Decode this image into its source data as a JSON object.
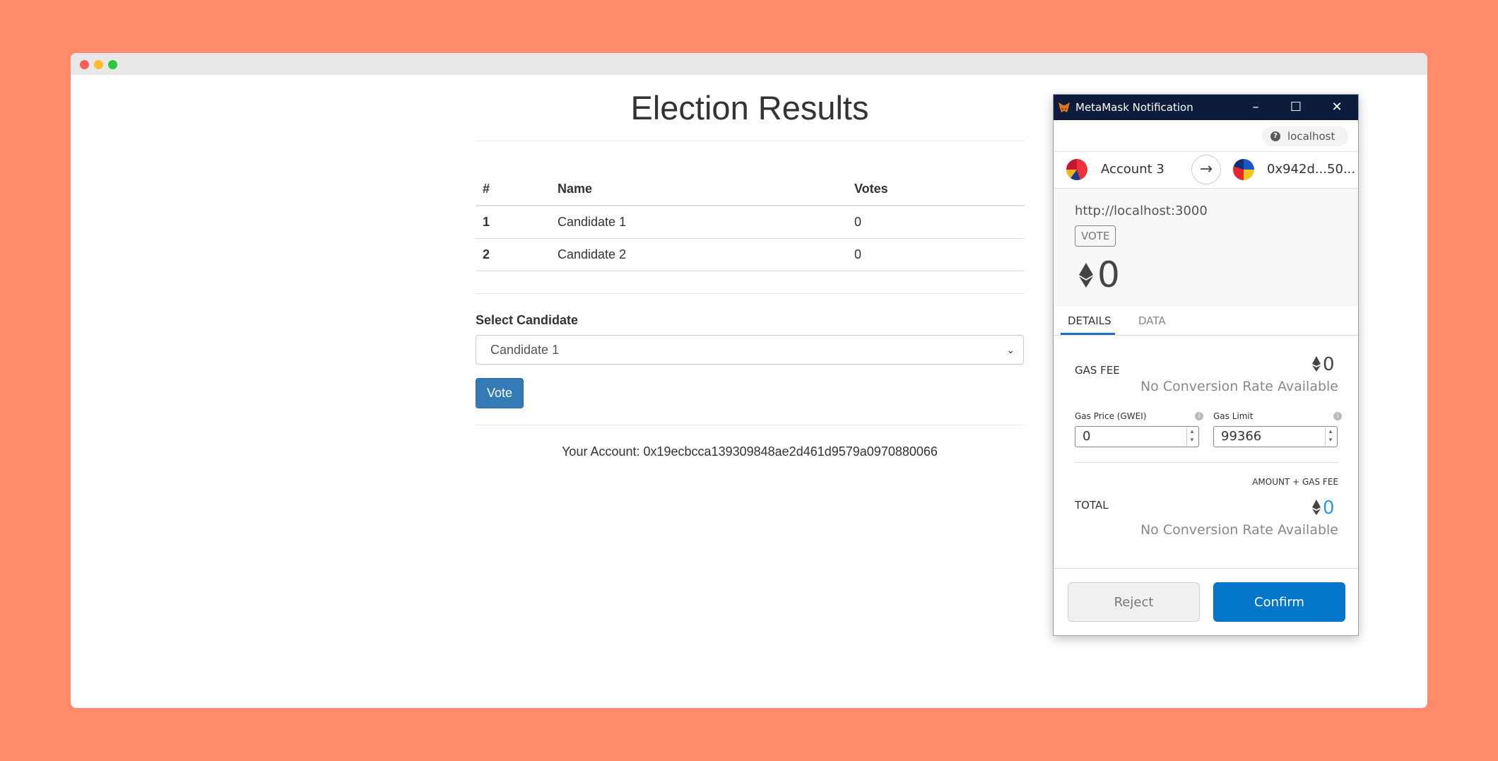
{
  "page": {
    "title": "Election Results",
    "table": {
      "headers": [
        "#",
        "Name",
        "Votes"
      ],
      "rows": [
        {
          "rank": "1",
          "name": "Candidate 1",
          "votes": "0"
        },
        {
          "rank": "2",
          "name": "Candidate 2",
          "votes": "0"
        }
      ]
    },
    "select_label": "Select Candidate",
    "selected_candidate": "Candidate 1",
    "vote_button": "Vote",
    "account_line": "Your Account: 0x19ecbcca139309848ae2d461d9579a0970880066"
  },
  "metamask": {
    "window_title": "MetaMask Notification",
    "origin": "localhost",
    "from_account": "Account 3",
    "to_address": "0x942d...50...",
    "site_url": "http://localhost:3000",
    "method": "VOTE",
    "amount": "0",
    "tabs": [
      "DETAILS",
      "DATA"
    ],
    "gas_fee_label": "GAS FEE",
    "gas_fee_value": "0",
    "no_conversion": "No Conversion Rate Available",
    "gas_price_label": "Gas Price (GWEI)",
    "gas_price_value": "0",
    "gas_limit_label": "Gas Limit",
    "gas_limit_value": "99366",
    "amount_gas_label": "AMOUNT + GAS FEE",
    "total_label": "TOTAL",
    "total_value": "0",
    "reject": "Reject",
    "confirm": "Confirm"
  },
  "colors": {
    "background": "#ff8b6a",
    "vote_button": "#337ab7",
    "metamask_titlebar": "#0d1b3d",
    "confirm_button": "#0376c9",
    "total_value": "#2f9ae0"
  }
}
